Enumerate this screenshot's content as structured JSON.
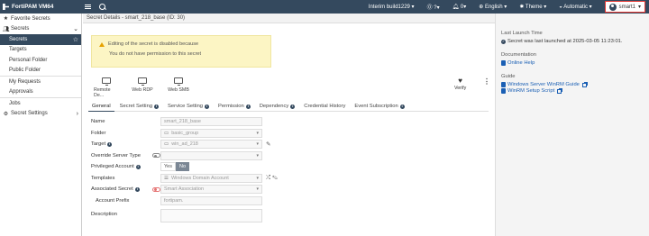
{
  "topbar": {
    "app_name": "FortiPAM VM64",
    "build": "Interim build1229",
    "help": "?",
    "notifications": "0",
    "language": "English",
    "theme": "Theme",
    "mode": "Automatic",
    "user": "smart1"
  },
  "sidebar": {
    "favorite": "Favorite Secrets",
    "secrets_group": "Secrets",
    "items": [
      {
        "label": "Secrets"
      },
      {
        "label": "Targets"
      },
      {
        "label": "Personal Folder"
      },
      {
        "label": "Public Folder"
      },
      {
        "label": "My Requests"
      },
      {
        "label": "Approvals"
      },
      {
        "label": "Jobs"
      }
    ],
    "settings": "Secret Settings"
  },
  "header": {
    "title": "Secret Details - smart_218_base (ID: 30)"
  },
  "warning": {
    "title": "Editing of the secret is disabled because",
    "bullet": "You do not have permission to this secret"
  },
  "launchers": [
    {
      "label": "Remote De..."
    },
    {
      "label": "Web RDP"
    },
    {
      "label": "Web SMB"
    }
  ],
  "verify_label": "Verify",
  "tabs": [
    {
      "label": "General"
    },
    {
      "label": "Secret Setting"
    },
    {
      "label": "Service Setting"
    },
    {
      "label": "Permission"
    },
    {
      "label": "Dependency"
    },
    {
      "label": "Credential History"
    },
    {
      "label": "Event Subscription"
    }
  ],
  "form": {
    "name_label": "Name",
    "name_value": "smart_218_base",
    "folder_label": "Folder",
    "folder_value": "basic_group",
    "target_label": "Target",
    "target_value": "win_ad_218",
    "override_label": "Override Server Type",
    "privileged_label": "Privileged Account",
    "yes": "Yes",
    "no": "No",
    "templates_label": "Templates",
    "templates_value": "Windows Domain Account",
    "assoc_label": "Associated Secret",
    "assoc_value": "Smart Association",
    "prefix_label": "Account Prefix",
    "prefix_value": "fortipam.",
    "description_label": "Description"
  },
  "right_panel": {
    "launch_title": "Last Launch Time",
    "launch_text": "Secret was last launched at 2025-03-05 11:23:01.",
    "doc_title": "Documentation",
    "online_help": "Online Help",
    "guide_title": "Guide",
    "guide1": "Windows Server WinRM Guide",
    "guide2": "WinRM Setup Script"
  }
}
